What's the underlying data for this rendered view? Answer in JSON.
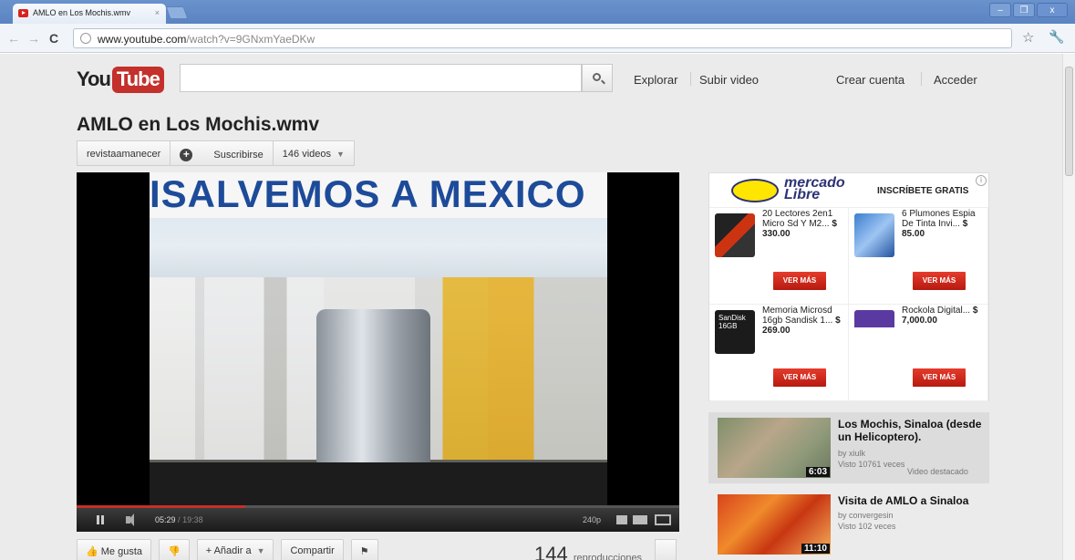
{
  "browser": {
    "tab_title": "AMLO en Los Mochis.wmv",
    "tab_close": "×",
    "url_host": "www.youtube.com",
    "url_path": "/watch?v=9GNxmYaeDKw",
    "back_glyph": "←",
    "forward_glyph": "→",
    "reload_glyph": "C",
    "star_glyph": "☆",
    "wrench_glyph": "🔧",
    "window_buttons": [
      "–",
      "❐",
      "x"
    ]
  },
  "header": {
    "logo_you": "You",
    "logo_tube": "Tube",
    "search_placeholder": "",
    "explore": "Explorar",
    "upload": "Subir video",
    "create_account": "Crear cuenta",
    "sign_in": "Acceder"
  },
  "video": {
    "title": "AMLO en Los Mochis.wmv",
    "banner_text": "ISALVEMOS A MEXICO",
    "channel": "revistaamanecer",
    "subscribe": "Suscribirse",
    "video_count": "146 videos",
    "current_time": "05:29",
    "duration": "19:38",
    "quality": "240p",
    "progress_fraction": 0.28
  },
  "actions": {
    "like": "Me gusta",
    "add_to": "+ Añadir a",
    "share": "Compartir",
    "views_number": "144",
    "views_label": "reproducciones"
  },
  "ad": {
    "brand_line1": "mercado",
    "brand_line2": "Libre",
    "cta": "INSCRÍBETE GRATIS",
    "info": "i",
    "button_label": "VER MÁS",
    "items": [
      {
        "name": "20 Lectores 2en1 Micro Sd Y M2...",
        "price": "$ 330.00"
      },
      {
        "name": "6 Plumones Espia De Tinta Invi...",
        "price": "$ 85.00"
      },
      {
        "name": "Memoria Microsd 16gb Sandisk 1...",
        "price": "$ 269.00"
      },
      {
        "name": "Rockola Digital...",
        "price": "$ 7,000.00"
      }
    ],
    "sandisk_logo": "SanDisk 16GB"
  },
  "related": [
    {
      "title": "Los Mochis, Sinaloa (desde un Helicoptero).",
      "by": "by xiulk",
      "views": "Visto 10761 veces",
      "duration": "6:03",
      "featured": "Video destacado"
    },
    {
      "title": "Visita de AMLO a Sinaloa",
      "by": "by convergesin",
      "views": "Visto 102 veces",
      "duration": "11:10"
    }
  ],
  "colors": {
    "youtube_red": "#c4302b",
    "chrome_blue": "#5a84c2",
    "ml_yellow": "#ffe600",
    "ver_mas_red": "#d42a1c"
  }
}
